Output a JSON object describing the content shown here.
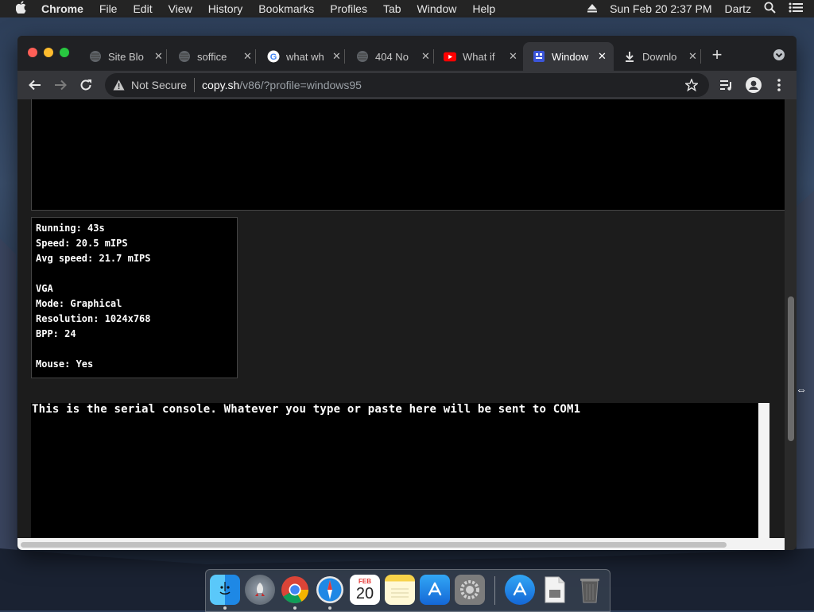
{
  "menubar": {
    "apple": "",
    "app": "Chrome",
    "items": [
      "File",
      "Edit",
      "View",
      "History",
      "Bookmarks",
      "Profiles",
      "Tab",
      "Window",
      "Help"
    ],
    "datetime": "Sun Feb 20  2:37 PM",
    "user": "Dartz"
  },
  "tabs": [
    {
      "title": "Site Blo",
      "icon": "globe-icon"
    },
    {
      "title": "soffice",
      "icon": "globe-icon"
    },
    {
      "title": "what wh",
      "icon": "google-icon"
    },
    {
      "title": "404 No",
      "icon": "globe-icon"
    },
    {
      "title": "What if",
      "icon": "youtube-icon"
    },
    {
      "title": "Window",
      "icon": "v86-icon",
      "active": true
    },
    {
      "title": "Downlo",
      "icon": "download-icon"
    }
  ],
  "toolbar": {
    "security": "Not Secure",
    "host": "copy.sh",
    "path": "/v86/?profile=windows95"
  },
  "stats": {
    "running": "Running: 43s",
    "speed": "Speed: 20.5 mIPS",
    "avg_speed": "Avg speed: 21.7 mIPS",
    "vga_header": "VGA",
    "mode": "Mode: Graphical",
    "resolution": "Resolution: 1024x768",
    "bpp": "BPP: 24",
    "mouse": "Mouse: Yes"
  },
  "serial_console": {
    "text": "This is the serial console. Whatever you type or paste here will be sent to COM1"
  },
  "dock": {
    "items": [
      "Finder",
      "Launchpad",
      "Chrome",
      "Safari",
      "Calendar",
      "Notes",
      "App Store",
      "System Preferences",
      "App Store",
      "Preview",
      "Trash"
    ],
    "calendar_month": "FEB",
    "calendar_day": "20"
  },
  "colors": {
    "accent": "#ff5f57",
    "yellow": "#febc2e",
    "green": "#28c840"
  }
}
